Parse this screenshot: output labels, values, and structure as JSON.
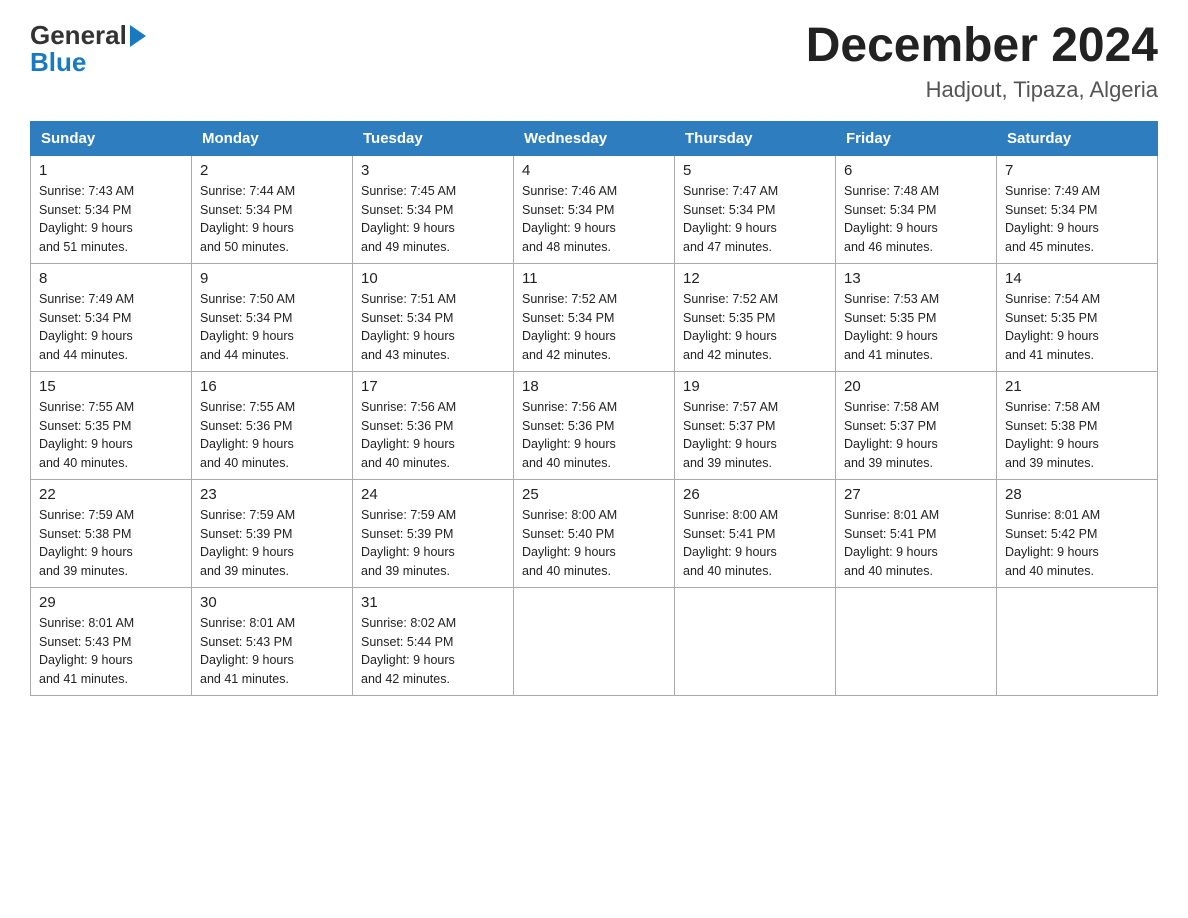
{
  "header": {
    "month_title": "December 2024",
    "location": "Hadjout, Tipaza, Algeria"
  },
  "days_of_week": [
    "Sunday",
    "Monday",
    "Tuesday",
    "Wednesday",
    "Thursday",
    "Friday",
    "Saturday"
  ],
  "weeks": [
    [
      {
        "day": "1",
        "info": "Sunrise: 7:43 AM\nSunset: 5:34 PM\nDaylight: 9 hours\nand 51 minutes."
      },
      {
        "day": "2",
        "info": "Sunrise: 7:44 AM\nSunset: 5:34 PM\nDaylight: 9 hours\nand 50 minutes."
      },
      {
        "day": "3",
        "info": "Sunrise: 7:45 AM\nSunset: 5:34 PM\nDaylight: 9 hours\nand 49 minutes."
      },
      {
        "day": "4",
        "info": "Sunrise: 7:46 AM\nSunset: 5:34 PM\nDaylight: 9 hours\nand 48 minutes."
      },
      {
        "day": "5",
        "info": "Sunrise: 7:47 AM\nSunset: 5:34 PM\nDaylight: 9 hours\nand 47 minutes."
      },
      {
        "day": "6",
        "info": "Sunrise: 7:48 AM\nSunset: 5:34 PM\nDaylight: 9 hours\nand 46 minutes."
      },
      {
        "day": "7",
        "info": "Sunrise: 7:49 AM\nSunset: 5:34 PM\nDaylight: 9 hours\nand 45 minutes."
      }
    ],
    [
      {
        "day": "8",
        "info": "Sunrise: 7:49 AM\nSunset: 5:34 PM\nDaylight: 9 hours\nand 44 minutes."
      },
      {
        "day": "9",
        "info": "Sunrise: 7:50 AM\nSunset: 5:34 PM\nDaylight: 9 hours\nand 44 minutes."
      },
      {
        "day": "10",
        "info": "Sunrise: 7:51 AM\nSunset: 5:34 PM\nDaylight: 9 hours\nand 43 minutes."
      },
      {
        "day": "11",
        "info": "Sunrise: 7:52 AM\nSunset: 5:34 PM\nDaylight: 9 hours\nand 42 minutes."
      },
      {
        "day": "12",
        "info": "Sunrise: 7:52 AM\nSunset: 5:35 PM\nDaylight: 9 hours\nand 42 minutes."
      },
      {
        "day": "13",
        "info": "Sunrise: 7:53 AM\nSunset: 5:35 PM\nDaylight: 9 hours\nand 41 minutes."
      },
      {
        "day": "14",
        "info": "Sunrise: 7:54 AM\nSunset: 5:35 PM\nDaylight: 9 hours\nand 41 minutes."
      }
    ],
    [
      {
        "day": "15",
        "info": "Sunrise: 7:55 AM\nSunset: 5:35 PM\nDaylight: 9 hours\nand 40 minutes."
      },
      {
        "day": "16",
        "info": "Sunrise: 7:55 AM\nSunset: 5:36 PM\nDaylight: 9 hours\nand 40 minutes."
      },
      {
        "day": "17",
        "info": "Sunrise: 7:56 AM\nSunset: 5:36 PM\nDaylight: 9 hours\nand 40 minutes."
      },
      {
        "day": "18",
        "info": "Sunrise: 7:56 AM\nSunset: 5:36 PM\nDaylight: 9 hours\nand 40 minutes."
      },
      {
        "day": "19",
        "info": "Sunrise: 7:57 AM\nSunset: 5:37 PM\nDaylight: 9 hours\nand 39 minutes."
      },
      {
        "day": "20",
        "info": "Sunrise: 7:58 AM\nSunset: 5:37 PM\nDaylight: 9 hours\nand 39 minutes."
      },
      {
        "day": "21",
        "info": "Sunrise: 7:58 AM\nSunset: 5:38 PM\nDaylight: 9 hours\nand 39 minutes."
      }
    ],
    [
      {
        "day": "22",
        "info": "Sunrise: 7:59 AM\nSunset: 5:38 PM\nDaylight: 9 hours\nand 39 minutes."
      },
      {
        "day": "23",
        "info": "Sunrise: 7:59 AM\nSunset: 5:39 PM\nDaylight: 9 hours\nand 39 minutes."
      },
      {
        "day": "24",
        "info": "Sunrise: 7:59 AM\nSunset: 5:39 PM\nDaylight: 9 hours\nand 39 minutes."
      },
      {
        "day": "25",
        "info": "Sunrise: 8:00 AM\nSunset: 5:40 PM\nDaylight: 9 hours\nand 40 minutes."
      },
      {
        "day": "26",
        "info": "Sunrise: 8:00 AM\nSunset: 5:41 PM\nDaylight: 9 hours\nand 40 minutes."
      },
      {
        "day": "27",
        "info": "Sunrise: 8:01 AM\nSunset: 5:41 PM\nDaylight: 9 hours\nand 40 minutes."
      },
      {
        "day": "28",
        "info": "Sunrise: 8:01 AM\nSunset: 5:42 PM\nDaylight: 9 hours\nand 40 minutes."
      }
    ],
    [
      {
        "day": "29",
        "info": "Sunrise: 8:01 AM\nSunset: 5:43 PM\nDaylight: 9 hours\nand 41 minutes."
      },
      {
        "day": "30",
        "info": "Sunrise: 8:01 AM\nSunset: 5:43 PM\nDaylight: 9 hours\nand 41 minutes."
      },
      {
        "day": "31",
        "info": "Sunrise: 8:02 AM\nSunset: 5:44 PM\nDaylight: 9 hours\nand 42 minutes."
      },
      {
        "day": "",
        "info": ""
      },
      {
        "day": "",
        "info": ""
      },
      {
        "day": "",
        "info": ""
      },
      {
        "day": "",
        "info": ""
      }
    ]
  ]
}
